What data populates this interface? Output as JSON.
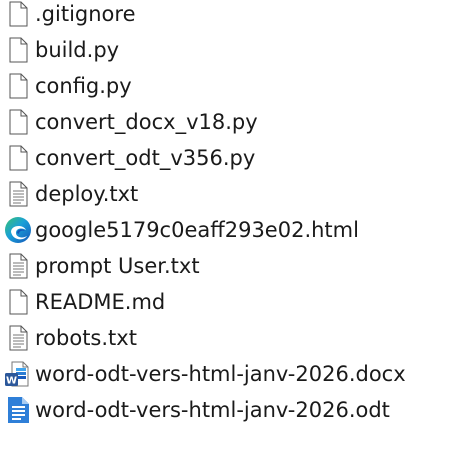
{
  "files": [
    {
      "name": ".gitignore",
      "icon": "blank-file-icon"
    },
    {
      "name": "build.py",
      "icon": "blank-file-icon"
    },
    {
      "name": "config.py",
      "icon": "blank-file-icon"
    },
    {
      "name": "convert_docx_v18.py",
      "icon": "blank-file-icon"
    },
    {
      "name": "convert_odt_v356.py",
      "icon": "blank-file-icon"
    },
    {
      "name": "deploy.txt",
      "icon": "text-file-icon"
    },
    {
      "name": "google5179c0eaff293e02.html",
      "icon": "edge-html-icon"
    },
    {
      "name": "prompt User.txt",
      "icon": "text-file-icon"
    },
    {
      "name": "README.md",
      "icon": "blank-file-icon"
    },
    {
      "name": "robots.txt",
      "icon": "text-file-icon"
    },
    {
      "name": "word-odt-vers-html-janv-2026.docx",
      "icon": "word-document-icon"
    },
    {
      "name": "word-odt-vers-html-janv-2026.odt",
      "icon": "odt-document-icon"
    }
  ],
  "colors": {
    "text": "#1a1a1a",
    "edge_blue": "#1f6fd6",
    "edge_green": "#3fbf6a",
    "word_blue": "#2b579a",
    "odt_blue": "#2f7fd8"
  }
}
